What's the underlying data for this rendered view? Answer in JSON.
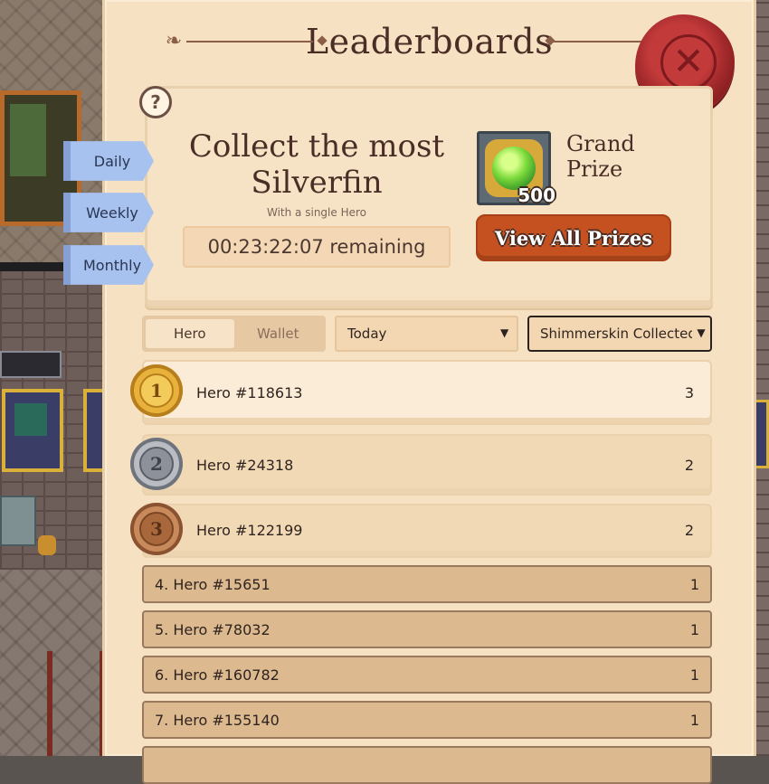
{
  "title": "Leaderboards",
  "periods": [
    "Daily",
    "Weekly",
    "Monthly"
  ],
  "banner": {
    "challenge_title": "Collect the most Silverfin",
    "challenge_subtitle": "With a single Hero",
    "timer": "00:23:22:07 remaining",
    "prize_label": "Grand Prize",
    "prize_quantity": "500",
    "view_prizes_label": "View All Prizes"
  },
  "filters": {
    "toggle_options": [
      "Hero",
      "Wallet"
    ],
    "active_toggle": "Hero",
    "period_value": "Today",
    "metric_value": "Shimmerskin Collected"
  },
  "top3": [
    {
      "rank": "1",
      "name": "Hero #118613",
      "score": "3",
      "medal": "gold"
    },
    {
      "rank": "2",
      "name": "Hero #24318",
      "score": "2",
      "medal": "silver"
    },
    {
      "rank": "3",
      "name": "Hero #122199",
      "score": "2",
      "medal": "bronze"
    }
  ],
  "ranks": [
    {
      "label": "4.  Hero #15651",
      "score": "1"
    },
    {
      "label": "5.  Hero #78032",
      "score": "1"
    },
    {
      "label": "6.  Hero #160782",
      "score": "1"
    },
    {
      "label": "7.  Hero #155140",
      "score": "1"
    }
  ],
  "colors": {
    "parchment": "#f7e1c3",
    "button_orange": "#c4511f",
    "ribbon_blue": "#a8c2ef",
    "seal_red": "#a42a2c"
  },
  "icons": {
    "close": "wax-seal-x-icon",
    "help": "question-icon",
    "prize": "green-gem-icon",
    "dropdown": "chevron-down-icon"
  }
}
